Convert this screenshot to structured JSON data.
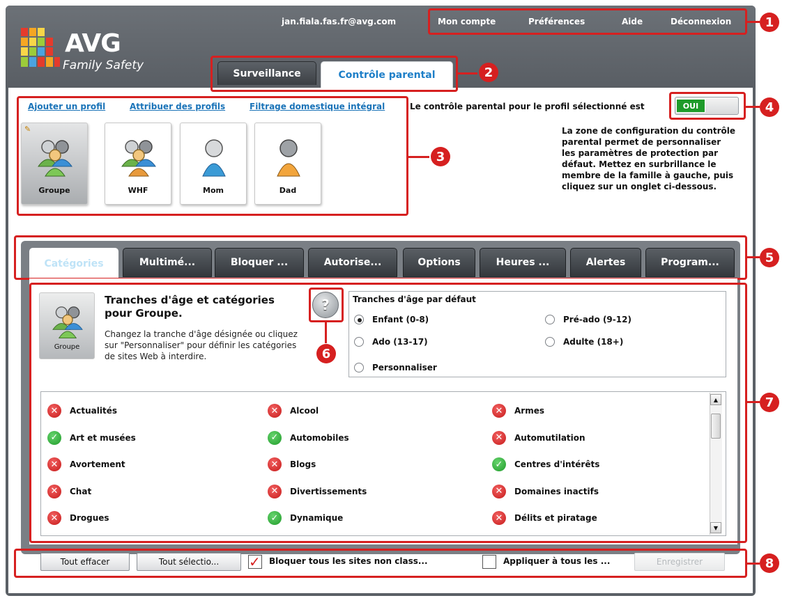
{
  "header": {
    "logo_brand": "AVG",
    "logo_product": "Family Safety",
    "email": "jan.fiala.fas.fr@avg.com",
    "nav": [
      "Mon compte",
      "Préférences",
      "Aide",
      "Déconnexion"
    ]
  },
  "main_tabs": [
    "Surveillance",
    "Contrôle parental"
  ],
  "profile_links": [
    "Ajouter un profil",
    "Attribuer des profils",
    "Filtrage domestique intégral"
  ],
  "status_text": "Le contrôle parental pour le profil sélectionné est",
  "toggle_label": "OUI",
  "info_text": "La zone de configuration du contrôle parental permet de personnaliser les paramètres de protection par défaut. Mettez en surbrillance le membre de la famille à gauche, puis cliquez sur un onglet ci-dessous.",
  "profiles": [
    "Groupe",
    "WHF",
    "Mom",
    "Dad"
  ],
  "sub_tabs": [
    "Catégories",
    "Multimé...",
    "Bloquer ...",
    "Autorise...",
    "Options",
    "Heures ...",
    "Alertes",
    "Program..."
  ],
  "group_panel": {
    "icon_label": "Groupe",
    "title": "Tranches d'âge et catégories pour Groupe.",
    "description": "Changez la tranche d'âge désignée ou cliquez sur \"Personnaliser\" pour définir les catégories de sites Web à interdire.",
    "help": "?"
  },
  "age_ranges": {
    "title": "Tranches d'âge par défaut",
    "options": [
      "Enfant (0-8)",
      "Pré-ado (9-12)",
      "Ado (13-17)",
      "Adulte (18+)",
      "Personnaliser"
    ],
    "selected": "Enfant (0-8)"
  },
  "categories": [
    {
      "label": "Actualités",
      "allowed": false
    },
    {
      "label": "Alcool",
      "allowed": false
    },
    {
      "label": "Armes",
      "allowed": false
    },
    {
      "label": "Art et musées",
      "allowed": true
    },
    {
      "label": "Automobiles",
      "allowed": true
    },
    {
      "label": "Automutilation",
      "allowed": false
    },
    {
      "label": "Avortement",
      "allowed": false
    },
    {
      "label": "Blogs",
      "allowed": false
    },
    {
      "label": "Centres d'intérêts",
      "allowed": true
    },
    {
      "label": "Chat",
      "allowed": false
    },
    {
      "label": "Divertissements",
      "allowed": false
    },
    {
      "label": "Domaines inactifs",
      "allowed": false
    },
    {
      "label": "Drogues",
      "allowed": false
    },
    {
      "label": "Dynamique",
      "allowed": true
    },
    {
      "label": "Délits et piratage",
      "allowed": false
    }
  ],
  "footer": {
    "clear_all": "Tout effacer",
    "select_all": "Tout sélectio...",
    "block_unclassified": "Bloquer tous les sites non class...",
    "apply_all": "Appliquer à tous les ...",
    "save": "Enregistrer"
  },
  "callouts": [
    "1",
    "2",
    "3",
    "4",
    "5",
    "6",
    "7",
    "8"
  ],
  "colors": {
    "callout": "#d62020",
    "link": "#1a73b8",
    "toggle_on": "#1e9b2a",
    "blocked": "#c51a1a",
    "allowed": "#1f9b2a"
  }
}
